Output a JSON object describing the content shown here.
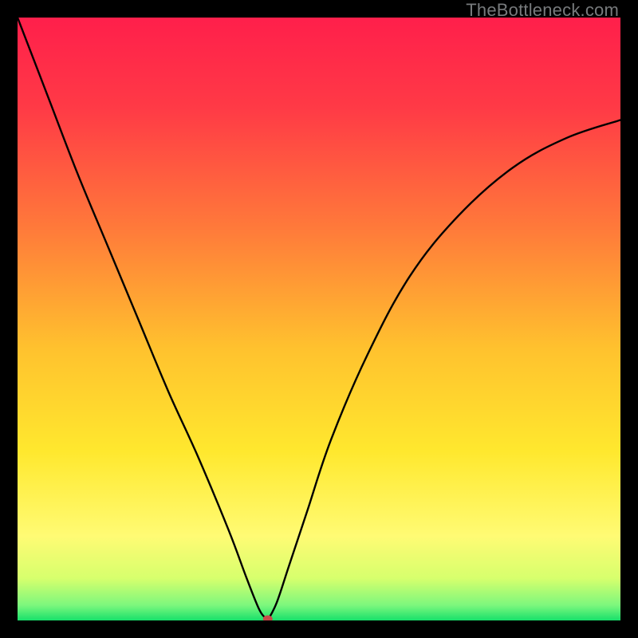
{
  "watermark": "TheBottleneck.com",
  "chart_data": {
    "type": "line",
    "title": "",
    "xlabel": "",
    "ylabel": "",
    "xlim": [
      0,
      100
    ],
    "ylim": [
      0,
      100
    ],
    "background_gradient_stops": [
      {
        "offset": 0.0,
        "color": "#ff1f4b"
      },
      {
        "offset": 0.15,
        "color": "#ff3a46"
      },
      {
        "offset": 0.35,
        "color": "#ff7a3a"
      },
      {
        "offset": 0.55,
        "color": "#ffc22e"
      },
      {
        "offset": 0.72,
        "color": "#ffe82e"
      },
      {
        "offset": 0.86,
        "color": "#fffb74"
      },
      {
        "offset": 0.93,
        "color": "#d7ff6d"
      },
      {
        "offset": 0.975,
        "color": "#7cf77d"
      },
      {
        "offset": 1.0,
        "color": "#17e06b"
      }
    ],
    "curve_left": {
      "x": [
        0,
        5,
        10,
        15,
        20,
        25,
        30,
        35,
        38,
        40,
        41,
        41.5
      ],
      "y": [
        100,
        87,
        74,
        62,
        50,
        38,
        27,
        15,
        7,
        2,
        0.5,
        0
      ]
    },
    "curve_right": {
      "x": [
        41.5,
        43,
        45,
        48,
        52,
        58,
        65,
        73,
        82,
        91,
        100
      ],
      "y": [
        0,
        3,
        9,
        18,
        30,
        44,
        57,
        67,
        75,
        80,
        83
      ]
    },
    "marker": {
      "x": 41.5,
      "y": 0,
      "color": "#c94a49",
      "rx": 6,
      "ry": 4.5
    }
  }
}
